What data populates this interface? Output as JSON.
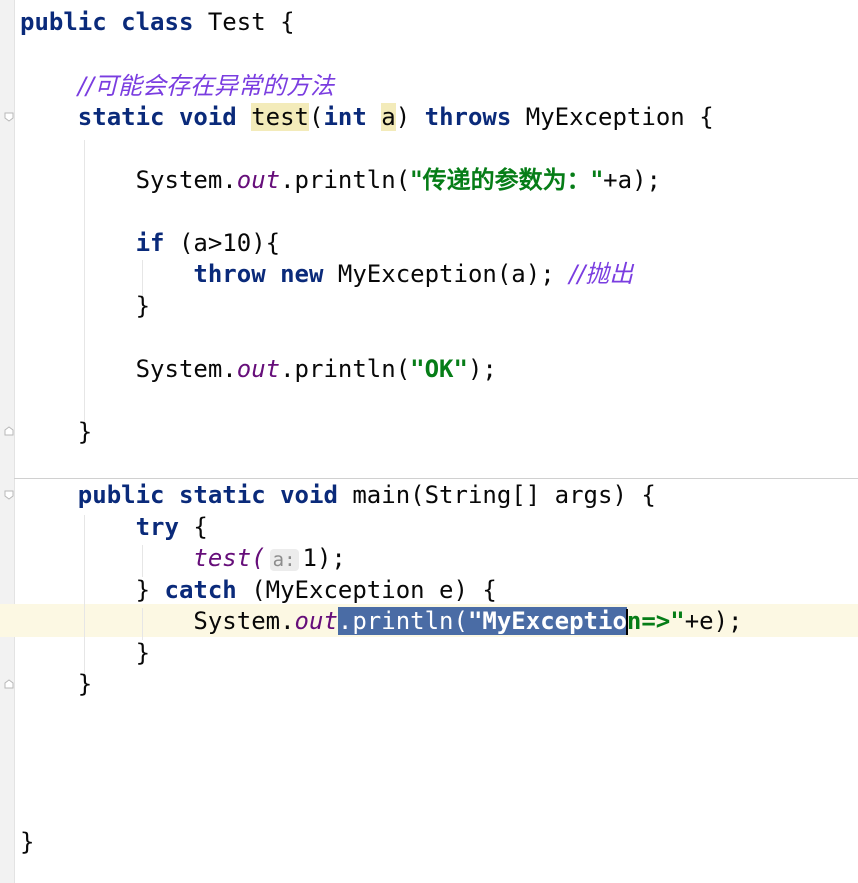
{
  "code": {
    "l1": {
      "kw_public": "public",
      "kw_class": "class",
      "name": "Test",
      "brace": "{"
    },
    "l2": {
      "comment": "//可能会存在异常的方法"
    },
    "l3": {
      "kw_static": "static",
      "kw_void": "void",
      "method": "test",
      "paren_open": "(",
      "kw_int": "int",
      "param": "a",
      "paren_close": ")",
      "kw_throws": "throws",
      "exception": "MyException",
      "brace": "{"
    },
    "l4": {
      "system": "System.",
      "out": "out",
      "println": ".println(",
      "str": "\"传递的参数为：\"",
      "rest": "+a);"
    },
    "l5": {
      "kw_if": "if",
      "cond": "(a>10){"
    },
    "l6": {
      "kw_throw": "throw",
      "kw_new": "new",
      "ctor": "MyException(a);",
      "comment": "//抛出"
    },
    "l7": {
      "brace": "}"
    },
    "l8": {
      "system": "System.",
      "out": "out",
      "println": ".println(",
      "str": "\"OK\"",
      "rest": ");"
    },
    "l9": {
      "brace": "}"
    },
    "l10": {
      "kw_public": "public",
      "kw_static": "static",
      "kw_void": "void",
      "rest": "main(String[] args) {"
    },
    "l11": {
      "kw_try": "try",
      "brace": "{"
    },
    "l12": {
      "call": "test(",
      "hint": "a:",
      "arg": "1);"
    },
    "l13": {
      "close": "}",
      "kw_catch": "catch",
      "rest": "(MyException e) {"
    },
    "l14": {
      "system": "System.",
      "out": "out",
      "sel_a": ".println(",
      "sel_str": "\"MyExceptio",
      "rest_str": "n=>\"",
      "rest": "+e);"
    },
    "l15": {
      "brace": "}"
    },
    "l16": {
      "brace": "}"
    },
    "l17": {
      "brace": "}"
    }
  }
}
